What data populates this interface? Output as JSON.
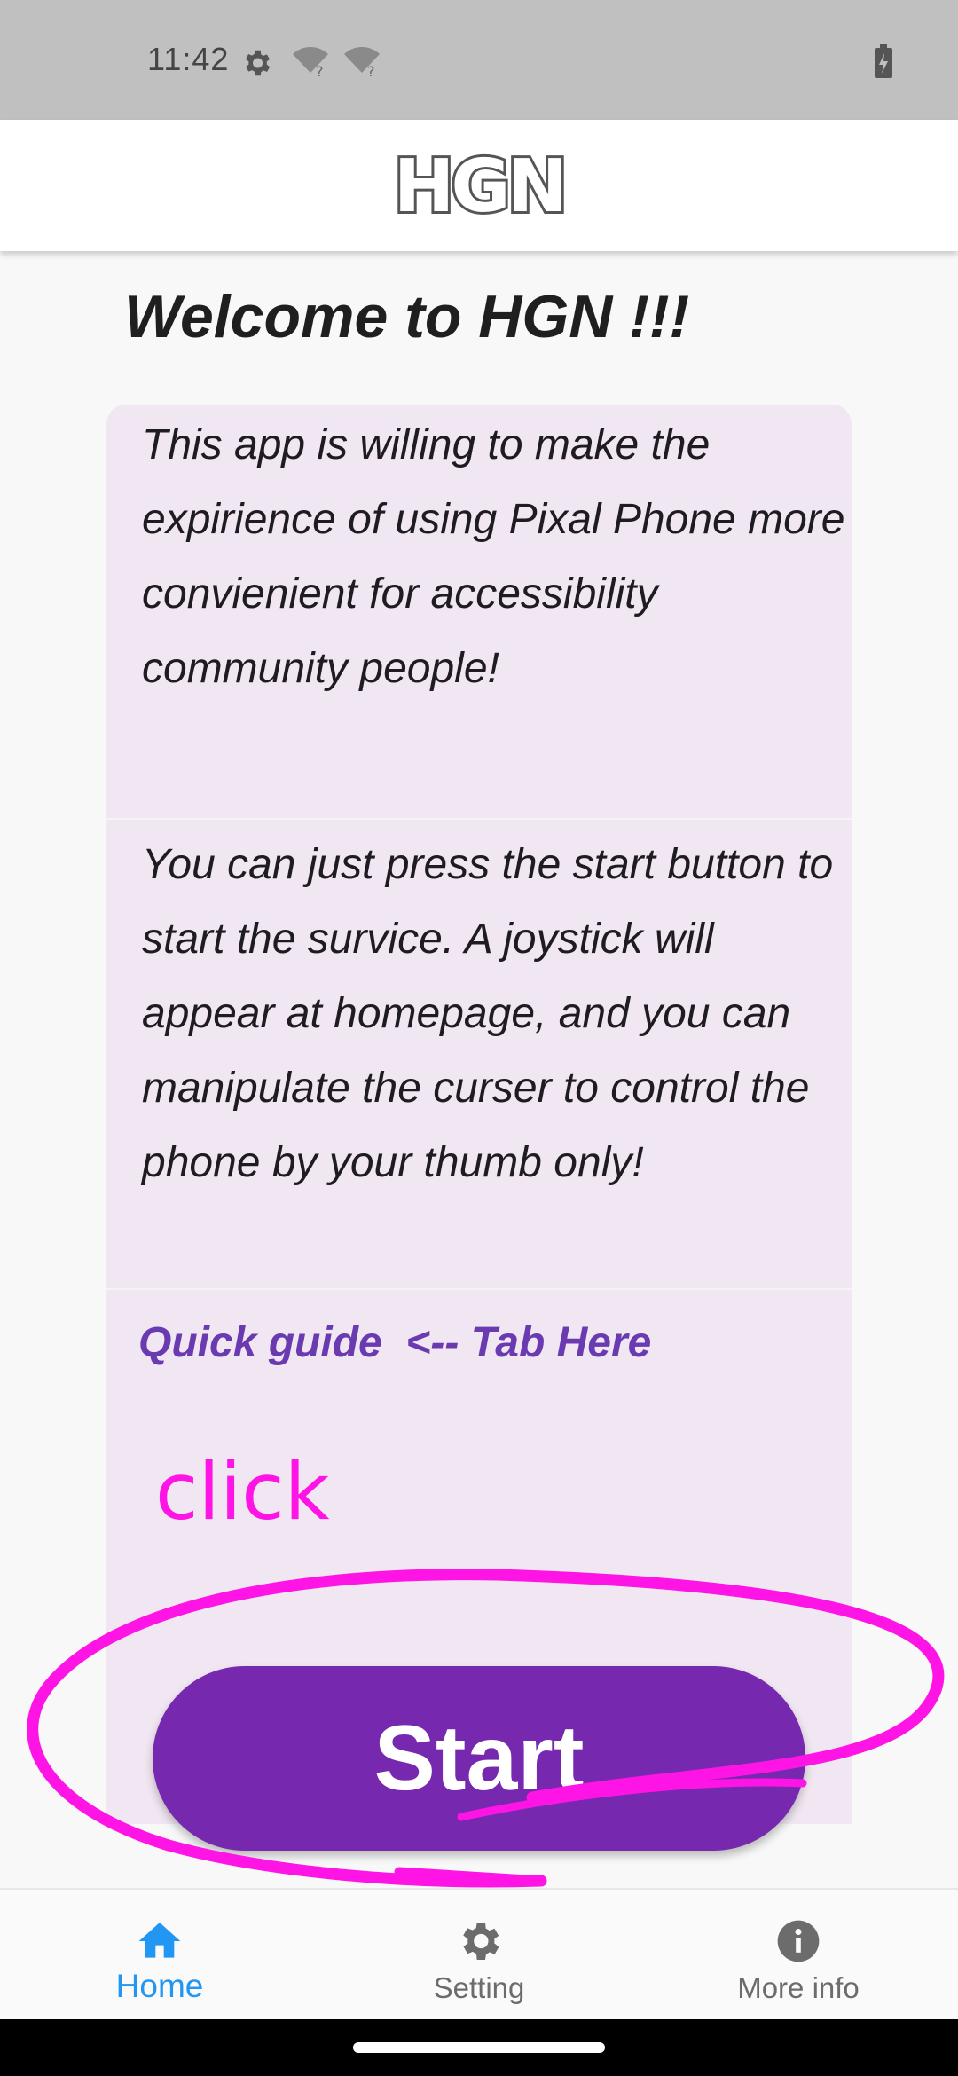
{
  "status_bar": {
    "time": "11:42",
    "icons": [
      "gear-icon",
      "wifi-unknown-icon",
      "wifi-unknown-icon",
      "battery-charging-icon"
    ]
  },
  "app_bar": {
    "logo_text": "HGN"
  },
  "main": {
    "title": "Welcome to HGN !!!",
    "paragraph1": "This app is willing to make the expirience of using Pixal Phone more convienient for accessibility community people!",
    "paragraph2": "You can just press the start button to start the survice. A joystick will appear at homepage, and you can manipulate the curser to control the phone by your thumb only!",
    "quick_guide": "Quick guide  <-- Tab Here",
    "start_button": "Start"
  },
  "annotation": {
    "text": "click",
    "color": "#ff14e6"
  },
  "bottom_nav": {
    "items": [
      {
        "label": "Home",
        "icon": "home-icon",
        "active": true
      },
      {
        "label": "Setting",
        "icon": "gear-icon",
        "active": false
      },
      {
        "label": "More info",
        "icon": "info-icon",
        "active": false
      }
    ]
  },
  "colors": {
    "accent": "#7628ae",
    "card_background": "#f1e7f2",
    "link": "#6a3ab0",
    "nav_active": "#2196f3"
  }
}
